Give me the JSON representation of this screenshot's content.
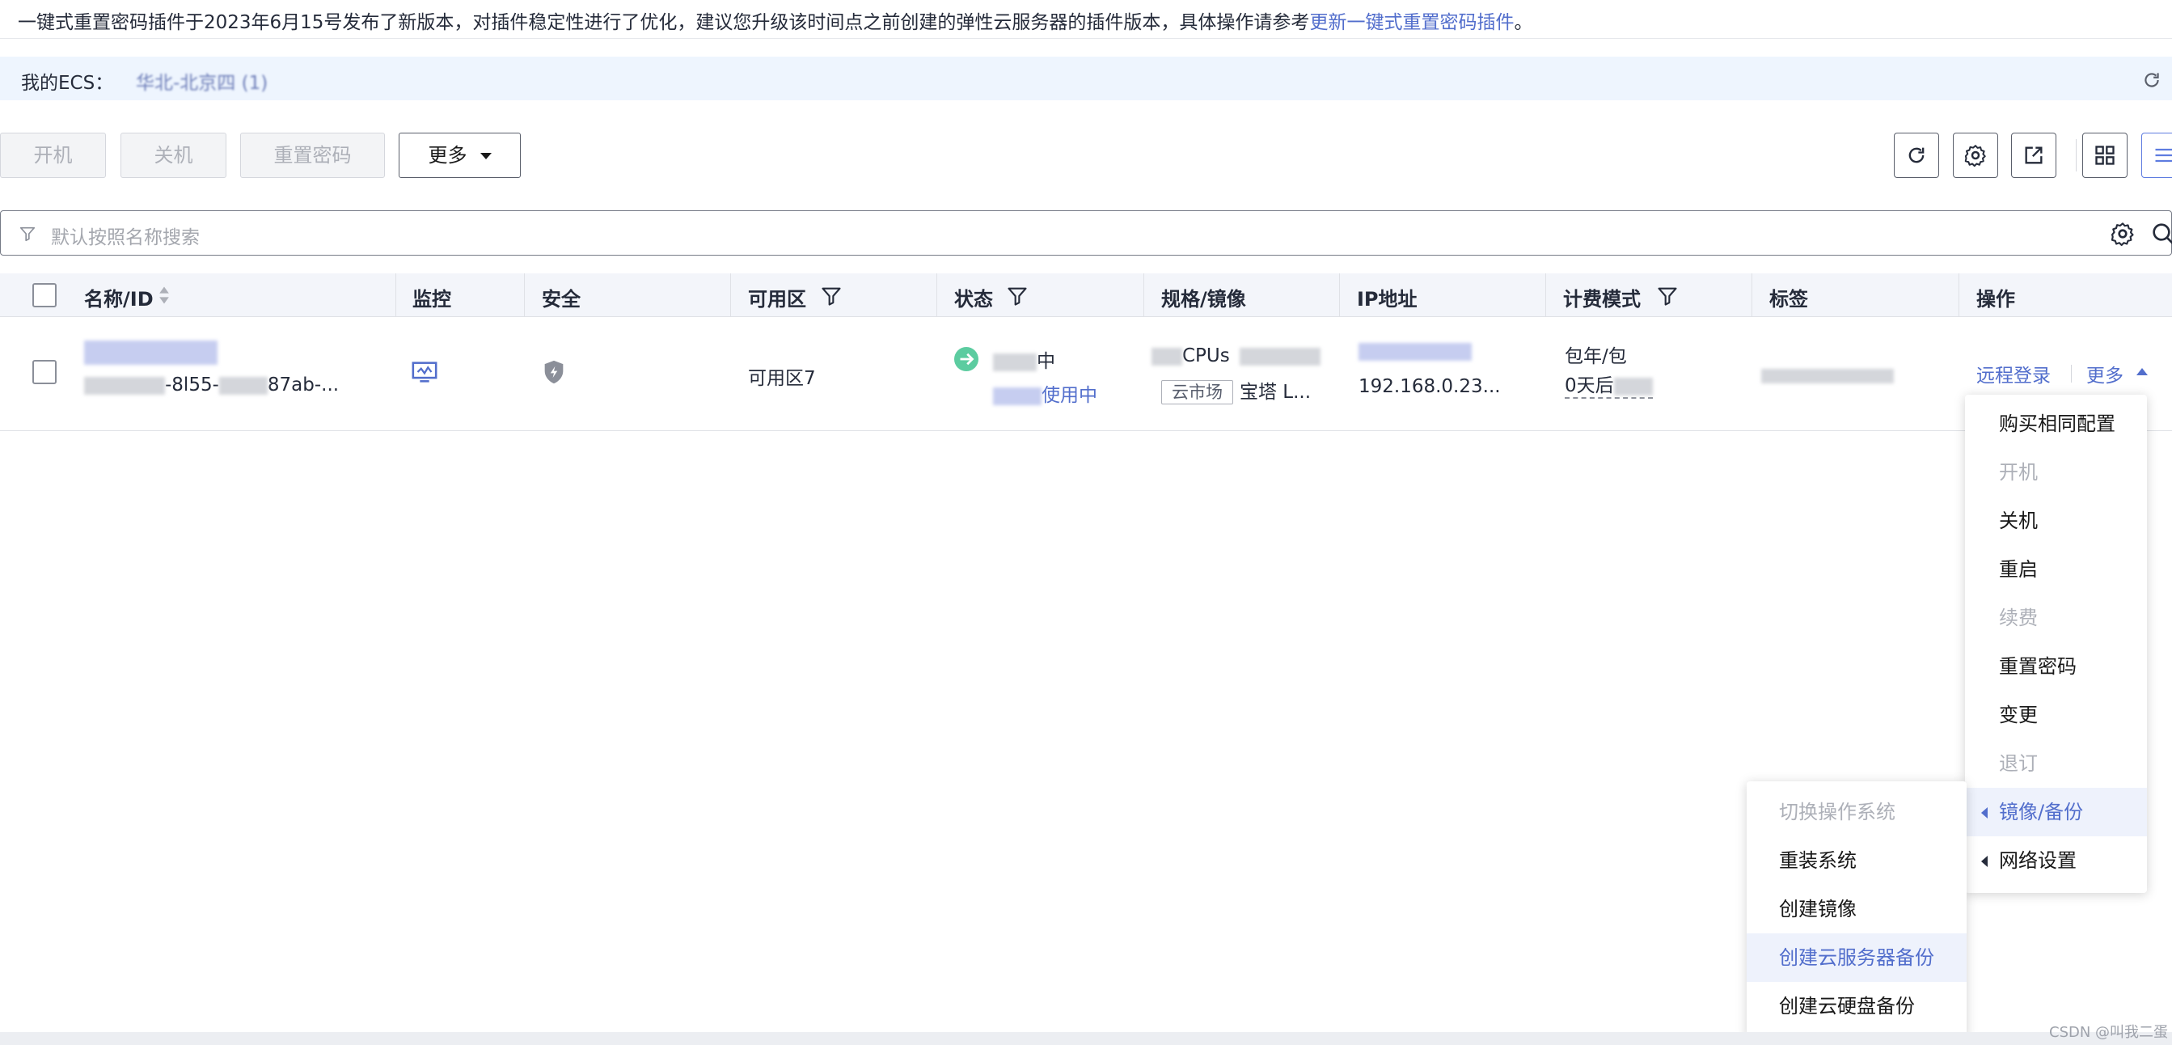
{
  "notice": {
    "text": "一键式重置密码插件于2023年6月15号发布了新版本，对插件稳定性进行了优化，建议您升级该时间点之前创建的弹性云服务器的插件版本，具体操作请参考",
    "link": "更新一键式重置密码插件",
    "end": "。"
  },
  "region_bar": {
    "label": "我的ECS：",
    "value": "华北-北京四 (1)",
    "refresh_icon": "refresh-icon"
  },
  "toolbar": {
    "start": "开机",
    "stop": "关机",
    "reset_password": "重置密码",
    "more": "更多"
  },
  "search": {
    "placeholder": "默认按照名称搜索"
  },
  "table": {
    "headers": {
      "name": "名称/ID",
      "monitor": "监控",
      "security": "安全",
      "az": "可用区",
      "status": "状态",
      "spec": "规格/镜像",
      "ip": "IP地址",
      "billing": "计费模式",
      "tags": "标签",
      "ops": "操作"
    },
    "row": {
      "id_fragment": "-8l55-",
      "id_tail": "87ab-...",
      "az": "可用区7",
      "status_suffix": "中",
      "status_sub": "使用中",
      "spec_line1": "CPUs",
      "market_tag": "云市场",
      "spec_line2_tail": "宝塔 L...",
      "ip_line2": "192.168.0.23...",
      "billing_line1": "包年/包",
      "billing_line2": "0天后",
      "remote_login": "远程登录",
      "more": "更多"
    }
  },
  "more_menu": [
    {
      "label": "购买相同配置",
      "disabled": false
    },
    {
      "label": "开机",
      "disabled": true
    },
    {
      "label": "关机",
      "disabled": false
    },
    {
      "label": "重启",
      "disabled": false
    },
    {
      "label": "续费",
      "disabled": true
    },
    {
      "label": "重置密码",
      "disabled": false
    },
    {
      "label": "变更",
      "disabled": false
    },
    {
      "label": "退订",
      "disabled": true
    },
    {
      "label": "镜像/备份",
      "disabled": false,
      "submenu": true,
      "highlighted": true
    },
    {
      "label": "网络设置",
      "disabled": false,
      "submenu": true
    }
  ],
  "image_backup_submenu": [
    {
      "label": "切换操作系统",
      "disabled": true
    },
    {
      "label": "重装系统",
      "disabled": false
    },
    {
      "label": "创建镜像",
      "disabled": false
    },
    {
      "label": "创建云服务器备份",
      "disabled": false,
      "highlighted": true
    },
    {
      "label": "创建云硬盘备份",
      "disabled": false
    }
  ],
  "watermark": "CSDN @叫我二蛋",
  "colors": {
    "link": "#526ecc",
    "status_running": "#5ccca0",
    "menu_highlight_bg": "#eef2fc"
  }
}
